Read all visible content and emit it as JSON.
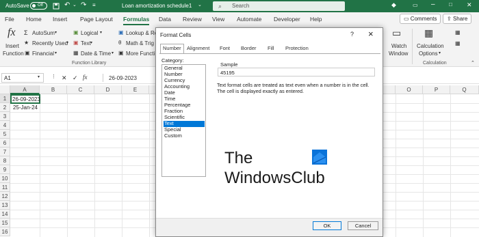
{
  "titlebar": {
    "autosave_label": "AutoSave",
    "autosave_state": "Off",
    "filename": "Loan amortization schedule1",
    "dropdown_caret": "⌄",
    "search_placeholder": "Search",
    "bg_color": "#217346"
  },
  "menu": {
    "tabs": [
      "File",
      "Home",
      "Insert",
      "Page Layout",
      "Formulas",
      "Data",
      "Review",
      "View",
      "Automate",
      "Developer",
      "Help"
    ],
    "active_tab": "Formulas",
    "comments_label": "Comments",
    "share_label": "Share"
  },
  "ribbon": {
    "insert_function": [
      "Insert",
      "Function"
    ],
    "autosum": "AutoSum",
    "recently_used": "Recently Used",
    "financial": "Financial",
    "logical": "Logical",
    "text": "Text",
    "datetime": "Date & Time",
    "lookup": "Lookup & Re",
    "math": "Math & Trig",
    "more_functions": "More Functi",
    "group_function_library": "Function Library",
    "watch_window": [
      "Watch",
      "Window"
    ],
    "calc_options": [
      "Calculation",
      "Options"
    ],
    "group_calculation": "Calculation"
  },
  "formula_bar": {
    "name_box": "A1",
    "fx": "fx",
    "value": "26-09-2023"
  },
  "sheet": {
    "columns": [
      "A",
      "B",
      "C",
      "D",
      "E",
      "F",
      "G",
      "H",
      "I",
      "J",
      "K",
      "L",
      "M",
      "N",
      "O",
      "P",
      "Q"
    ],
    "rows": [
      "1",
      "2",
      "3",
      "4",
      "5",
      "6",
      "7",
      "8",
      "9",
      "10",
      "11",
      "12",
      "13",
      "14",
      "15",
      "16"
    ],
    "a1": "26-09-2023",
    "a2": "25-Jan-24"
  },
  "dialog": {
    "title": "Format Cells",
    "help": "?",
    "close": "×",
    "tabs": [
      "Number",
      "Alignment",
      "Font",
      "Border",
      "Fill",
      "Protection"
    ],
    "active_tab": "Number",
    "category_label": "Category:",
    "categories": [
      "General",
      "Number",
      "Currency",
      "Accounting",
      "Date",
      "Time",
      "Percentage",
      "Fraction",
      "Scientific",
      "Text",
      "Special",
      "Custom"
    ],
    "selected_category": "Text",
    "sample_label": "Sample",
    "sample_value": "45195",
    "description": [
      "Text format cells are treated as text even when a number is in the cell.",
      "The cell is displayed exactly as entered."
    ],
    "watermark_line1": "The",
    "watermark_line2": "WindowsClub",
    "ok_label": "OK",
    "cancel_label": "Cancel",
    "accent_color": "#0078d7"
  }
}
